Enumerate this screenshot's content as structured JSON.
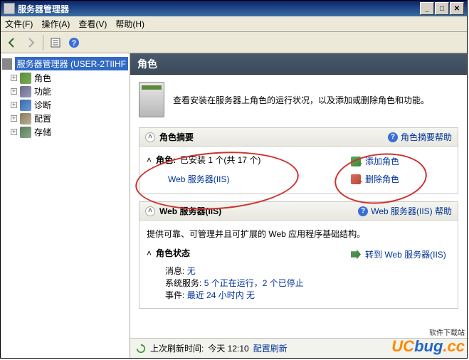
{
  "window": {
    "title": "服务器管理器"
  },
  "menu": {
    "file": "文件(F)",
    "action": "操作(A)",
    "view": "查看(V)",
    "help": "帮助(H)"
  },
  "tree": {
    "root": "服务器管理器 (USER-2TIIHF",
    "items": [
      {
        "label": "角色"
      },
      {
        "label": "功能"
      },
      {
        "label": "诊断"
      },
      {
        "label": "配置"
      },
      {
        "label": "存储"
      }
    ]
  },
  "content": {
    "header": "角色",
    "intro": "查看安装在服务器上角色的运行状况，以及添加或删除角色和功能。",
    "summary": {
      "title": "角色摘要",
      "help": "角色摘要帮助",
      "roles_label": "角色:",
      "roles_value": "已安装 1 个(共 17 个)",
      "iis_link": "Web 服务器(IIS)",
      "add_role": "添加角色",
      "del_role": "删除角色"
    },
    "iis": {
      "title": "Web 服务器(IIS)",
      "help": "Web 服务器(IIS) 帮助",
      "desc": "提供可靠、可管理并且可扩展的 Web 应用程序基础结构。",
      "status_title": "角色状态",
      "goto": "转到 Web 服务器(IIS)",
      "msg_label": "消息:",
      "msg_val": "无",
      "svc_label": "系统服务:",
      "svc_val": "5 个正在运行，2 个已停止",
      "evt_label": "事件:",
      "evt_val": "最近 24 小时内 无"
    }
  },
  "status": {
    "prefix": "上次刷新时间:",
    "time": "今天 12:10",
    "refresh": "配置刷新"
  },
  "watermark": {
    "brand": "UCbug.cc",
    "tag": "软件下载站"
  }
}
